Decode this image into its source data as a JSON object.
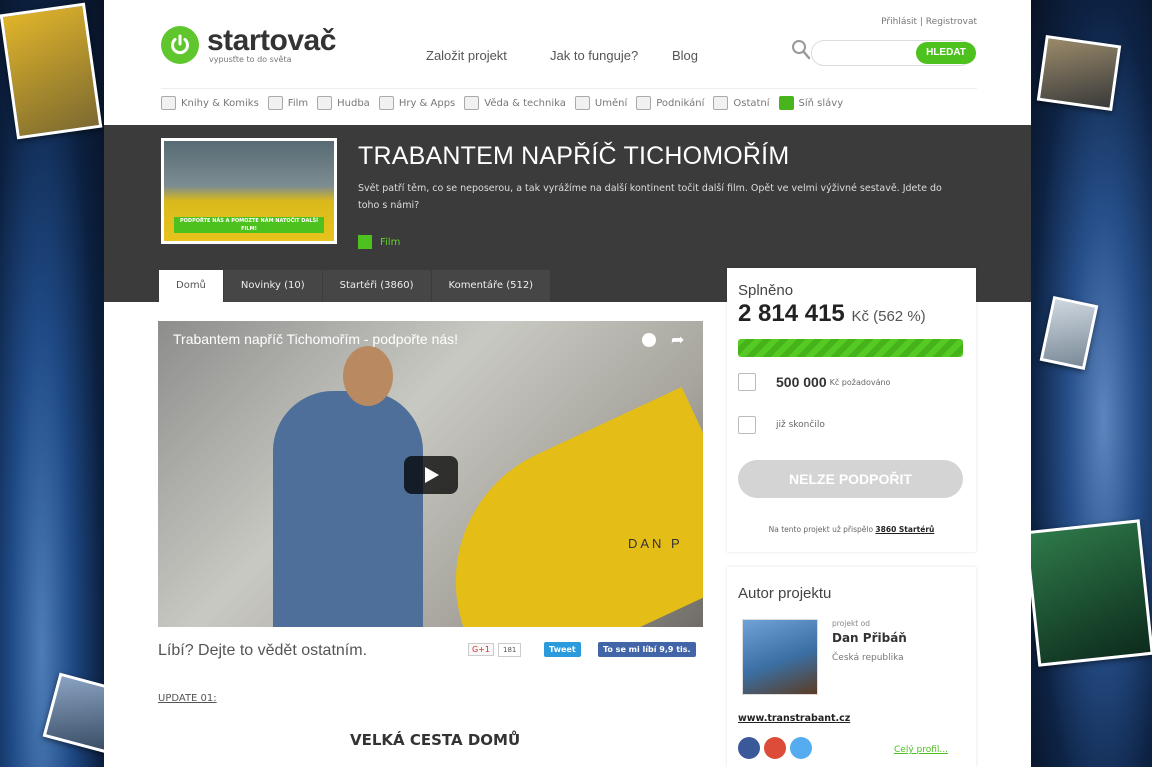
{
  "header": {
    "logo_name": "startovač",
    "logo_tagline": "vypusťte to do světa",
    "login": "Přihlásit | Registrovat",
    "nav": [
      "Založit projekt",
      "Jak to funguje?",
      "Blog"
    ],
    "search_placeholder": "",
    "search_button": "HLEDAT"
  },
  "categories": [
    "Knihy & Komiks",
    "Film",
    "Hudba",
    "Hry & Apps",
    "Věda & technika",
    "Umění",
    "Podnikání",
    "Ostatní",
    "Síň slávy"
  ],
  "project": {
    "thumb_banner": "PODPOŘTE NÁS A POMOZTE NÁM NATOČIT DALŠÍ FILM!",
    "title": "TRABANTEM NAPŘÍČ TICHOMOŘÍM",
    "description": "Svět patří těm, co se neposerou, a tak vyrážíme na další kontinent točit další film. Opět ve velmi výživné sestavě. Jdete do toho s námi?",
    "category": "Film"
  },
  "tabs": [
    "Domů",
    "Novinky (10)",
    "Startéři (3860)",
    "Komentáře (512)"
  ],
  "video": {
    "title": "Trabantem napříč Tichomořím - podpořte nás!",
    "car_text": "DAN P"
  },
  "share": {
    "prompt": "Líbí? Dejte to vědět ostatním.",
    "gplus": "G+1",
    "gplus_count": "181",
    "tweet": "Tweet",
    "fb_like": "To se mi líbí 9,9 tis."
  },
  "content": {
    "update_link": "UPDATE 01:",
    "heading": "VELKÁ CESTA DOMŮ"
  },
  "funding": {
    "label": "Splněno",
    "amount": "2 814 415",
    "currency_percent": "Kč (562 %)",
    "progress_fraction": 1.0,
    "goal_amount": "500 000",
    "goal_label": "Kč požadováno",
    "status": "již skončilo",
    "button": "NELZE PODPOŘIT",
    "backers_prefix": "Na tento projekt už přispělo",
    "backers_link": "3860 Startérů"
  },
  "author": {
    "heading": "Autor projektu",
    "by_label": "projekt od",
    "name": "Dan Přibáň",
    "country": "Česká republika",
    "website": "www.transtrabant.cz",
    "profile_link": "Celý profil..."
  },
  "colors": {
    "brand_green": "#4dc21f",
    "dark_band": "#3b3b3b",
    "facebook": "#3b5998",
    "gplus": "#dd4b39",
    "twitter": "#55acee"
  },
  "icons": [
    "power-icon",
    "search-icon",
    "clock-icon",
    "share-icon",
    "play-icon",
    "checkbox-icon",
    "calendar-icon",
    "facebook-icon",
    "gplus-icon",
    "twitter-icon"
  ]
}
